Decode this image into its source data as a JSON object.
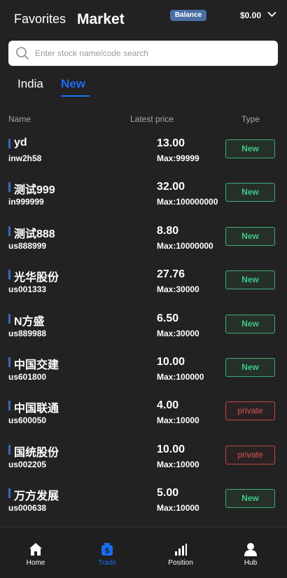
{
  "header": {
    "favorites_label": "Favorites",
    "title": "Market",
    "balance_badge": "Balance",
    "balance_amount": "$0.00"
  },
  "search": {
    "placeholder": "Enter stock name/code search",
    "value": ""
  },
  "tabs": [
    {
      "label": "India",
      "active": false
    },
    {
      "label": "New",
      "active": true
    }
  ],
  "columns": {
    "name": "Name",
    "price": "Latest price",
    "type": "Type"
  },
  "stocks": [
    {
      "name": "yd",
      "code": "inw2h58",
      "price": "13.00",
      "max": "Max:99999",
      "type": "New"
    },
    {
      "name": "测试999",
      "code": "in999999",
      "price": "32.00",
      "max": "Max:100000000",
      "type": "New"
    },
    {
      "name": "测试888",
      "code": "us888999",
      "price": "8.80",
      "max": "Max:10000000",
      "type": "New"
    },
    {
      "name": "光华股份",
      "code": "us001333",
      "price": "27.76",
      "max": "Max:30000",
      "type": "New"
    },
    {
      "name": "N方盛",
      "code": "us889988",
      "price": "6.50",
      "max": "Max:30000",
      "type": "New"
    },
    {
      "name": "中国交建",
      "code": "us601800",
      "price": "10.00",
      "max": "Max:100000",
      "type": "New"
    },
    {
      "name": "中国联通",
      "code": "us600050",
      "price": "4.00",
      "max": "Max:10000",
      "type": "private"
    },
    {
      "name": "国统股份",
      "code": "us002205",
      "price": "10.00",
      "max": "Max:10000",
      "type": "private"
    },
    {
      "name": "万方发展",
      "code": "us000638",
      "price": "5.00",
      "max": "Max:10000",
      "type": "New"
    }
  ],
  "bottom_nav": [
    {
      "label": "Home",
      "icon": "home-icon",
      "active": false
    },
    {
      "label": "Trade",
      "icon": "trade-icon",
      "active": true
    },
    {
      "label": "Position",
      "icon": "position-icon",
      "active": false
    },
    {
      "label": "Hub",
      "icon": "hub-icon",
      "active": false
    }
  ],
  "colors": {
    "background": "#222222",
    "accent": "#1a6cf0",
    "badge": "#4a6fa5",
    "new_type": "#3fc88a",
    "private_type": "#d95555",
    "name_marker": "#3a68b8"
  }
}
